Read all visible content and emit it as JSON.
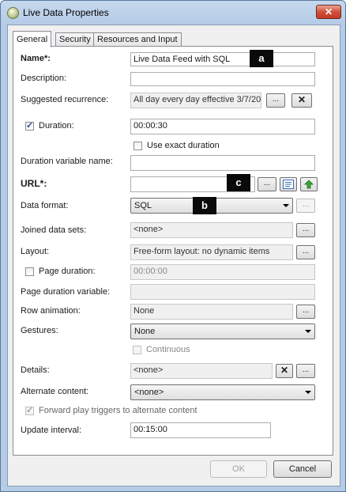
{
  "window": {
    "title": "Live Data Properties",
    "close_glyph": "✕"
  },
  "tabs": [
    {
      "label": "General"
    },
    {
      "label": "Security"
    },
    {
      "label": "Resources and Input"
    }
  ],
  "fields": {
    "name": {
      "label": "Name*:",
      "value": "Live Data Feed with SQL"
    },
    "description": {
      "label": "Description:",
      "value": ""
    },
    "recurrence": {
      "label": "Suggested recurrence:",
      "value": "All day every day effective 3/7/20",
      "browse": "...",
      "clear": "✕"
    },
    "duration": {
      "label": "Duration:",
      "checked": true,
      "value": "00:00:30"
    },
    "exact_duration": {
      "label": "Use exact duration",
      "checked": false
    },
    "duration_var": {
      "label": "Duration variable name:",
      "value": ""
    },
    "url": {
      "label": "URL*:",
      "value": "",
      "browse": "..."
    },
    "data_format": {
      "label": "Data format:",
      "value": "SQL",
      "more": "..."
    },
    "joined": {
      "label": "Joined data sets:",
      "value": "<none>",
      "more": "..."
    },
    "layout": {
      "label": "Layout:",
      "value": "Free-form layout: no dynamic items",
      "more": "..."
    },
    "page_duration": {
      "label": "Page duration:",
      "checked": false,
      "value": "00:00:00"
    },
    "page_duration_var": {
      "label": "Page duration variable:",
      "value": ""
    },
    "row_animation": {
      "label": "Row animation:",
      "value": "None",
      "more": "..."
    },
    "gestures": {
      "label": "Gestures:",
      "value": "None"
    },
    "continuous": {
      "label": "Continuous",
      "checked": false
    },
    "details": {
      "label": "Details:",
      "value": "<none>",
      "clear": "✕",
      "more": "..."
    },
    "alternate": {
      "label": "Alternate content:",
      "value": "<none>"
    },
    "forward_play": {
      "label": "Forward play triggers to alternate content",
      "checked": true
    },
    "update_interval": {
      "label": "Update interval:",
      "value": "00:15:00"
    }
  },
  "callouts": {
    "a": "a",
    "b": "b",
    "c": "c"
  },
  "footer": {
    "ok": "OK",
    "cancel": "Cancel"
  },
  "icons": {
    "check": "✓"
  }
}
